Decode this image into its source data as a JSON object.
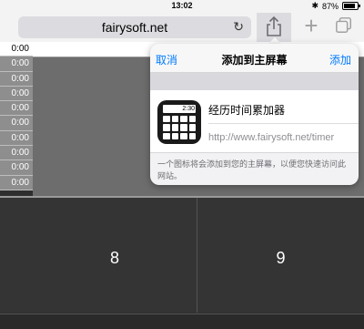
{
  "status_bar": {
    "time": "13:02",
    "battery_text": "87%",
    "battery_level": 0.87
  },
  "browser": {
    "url_text": "fairysoft.net",
    "reload_icon": "reload-icon",
    "share_icon": "share-icon",
    "new_tab_icon": "plus-icon",
    "tabs_icon": "tabs-icon"
  },
  "timeline": {
    "rows": [
      "0:00",
      "0:00",
      "0:00",
      "0:00",
      "0:00",
      "0:00",
      "0:00",
      "0:00",
      "0:00",
      "0:00",
      "0:00"
    ]
  },
  "grid": {
    "cells": [
      {
        "label": ""
      },
      {
        "label": "8"
      },
      {
        "label": "9"
      }
    ]
  },
  "popover": {
    "cancel_label": "取消",
    "title": "添加到主屏幕",
    "add_label": "添加",
    "app_name": "经历时间累加器",
    "app_url": "http://www.fairysoft.net/timer",
    "app_icon_display": "2:30",
    "footer_text": "一个图标将会添加到您的主屏幕，以便您快速访问此网站。"
  },
  "colors": {
    "accent": "#007aff"
  }
}
